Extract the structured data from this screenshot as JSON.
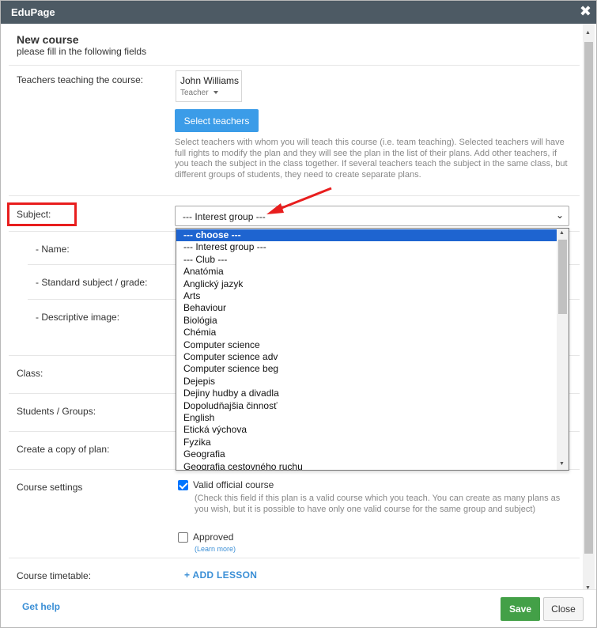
{
  "window": {
    "title": "EduPage",
    "close_icon": "close-icon"
  },
  "header": {
    "title": "New course",
    "subtitle": "please fill in the following fields"
  },
  "teachers": {
    "label": "Teachers teaching the course:",
    "teacher_name": "John Williams",
    "teacher_role": "Teacher",
    "select_button": "Select teachers",
    "help_text": "Select teachers with whom you will teach this course (i.e. team teaching). Selected teachers will have full rights to modify the plan and they will see the plan in the list of their plans. Add other teachers, if you teach the subject in the class together. If several teachers teach the subject in the same class, but different groups of students, they need to create separate plans."
  },
  "subject": {
    "label": "Subject:",
    "selected_value": "--- Interest group ---",
    "options": [
      "--- choose ---",
      "--- Interest group ---",
      "--- Club ---",
      "Anatómia",
      "Anglický jazyk",
      "Arts",
      "Behaviour",
      "Biológia",
      "Chémia",
      "Computer science",
      "Computer science adv",
      "Computer science beg",
      "Dejepis",
      "Dejiny hudby a divadla",
      "Dopoludňajšia činnosť",
      "English",
      "Etická výchova",
      "Fyzika",
      "Geografia",
      "Geografia cestovného ruchu"
    ],
    "highlighted_option": "--- choose ---"
  },
  "fields": {
    "name_label": "- Name:",
    "standard_label": "- Standard subject / grade:",
    "image_label": "- Descriptive image:",
    "class_label": "Class:",
    "students_label": "Students / Groups:",
    "copy_label": "Create a copy of plan:",
    "settings_label": "Course settings",
    "timetable_label": "Course timetable:"
  },
  "settings": {
    "valid_label": "Valid official course",
    "valid_checked": true,
    "valid_note": "(Check this field if this plan is a valid course which you teach. You can create as many plans as you wish, but it is possible to have only one valid course for the same group and subject)",
    "approved_label": "Approved",
    "approved_checked": false,
    "learn_more": "(Learn more)"
  },
  "timetable": {
    "add_lesson": "+ ADD LESSON"
  },
  "footer": {
    "get_help": "Get help",
    "save": "Save",
    "close": "Close"
  },
  "colors": {
    "titlebar": "#4d5a64",
    "accent": "#3b9ce8",
    "save": "#43a047",
    "highlight": "#e81e1e",
    "selected_option": "#1e64d0"
  }
}
